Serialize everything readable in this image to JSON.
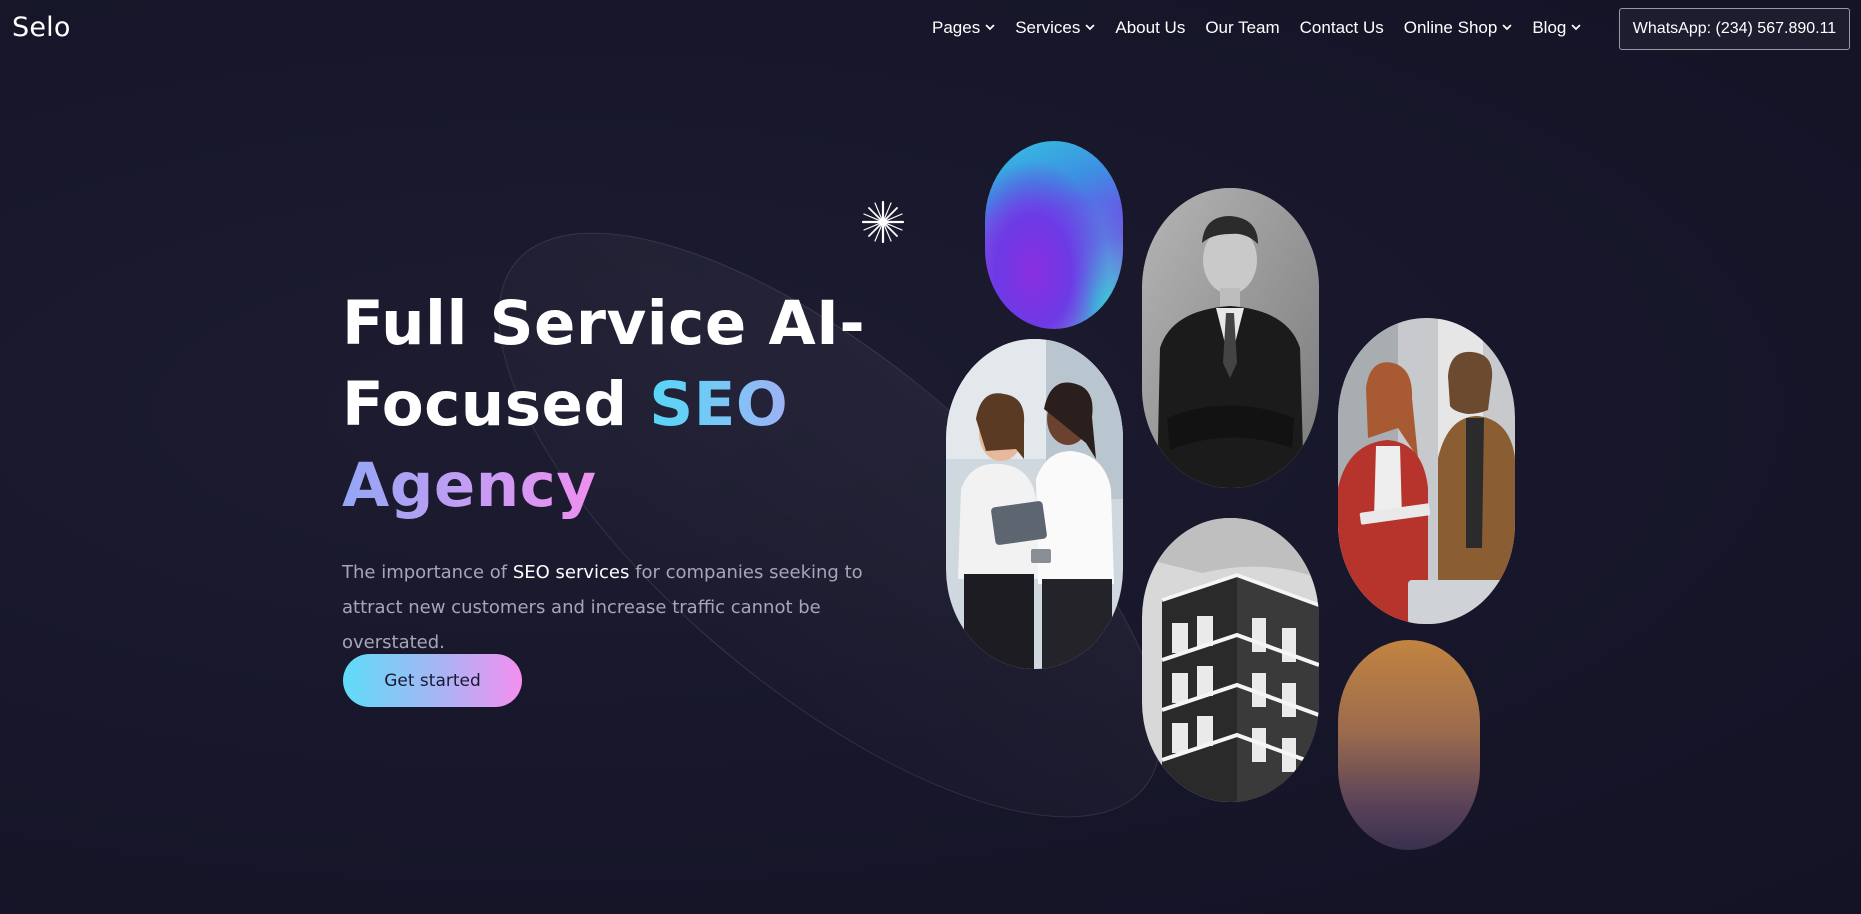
{
  "brand": "Selo",
  "nav": {
    "items": [
      {
        "label": "Pages",
        "dropdown": true
      },
      {
        "label": "Services",
        "dropdown": true
      },
      {
        "label": "About Us",
        "dropdown": false
      },
      {
        "label": "Our Team",
        "dropdown": false
      },
      {
        "label": "Contact Us",
        "dropdown": false
      },
      {
        "label": "Online Shop",
        "dropdown": true
      },
      {
        "label": "Blog",
        "dropdown": true
      }
    ],
    "whatsapp": "WhatsApp: (234) 567.890.11"
  },
  "hero": {
    "headline_line1": "Full Service AI-",
    "headline_line2_plain": "Focused ",
    "headline_line2_accent": "SEO",
    "headline_line3_accent": "Agency",
    "sub_before": "The importance of ",
    "sub_strong": "SEO services",
    "sub_after": " for companies seeking to attract new customers and increase traffic cannot be overstated.",
    "cta": "Get started"
  },
  "colors": {
    "background": "#17162a",
    "accent_cyan": "#55d6f7",
    "accent_pink": "#f08ff0"
  }
}
